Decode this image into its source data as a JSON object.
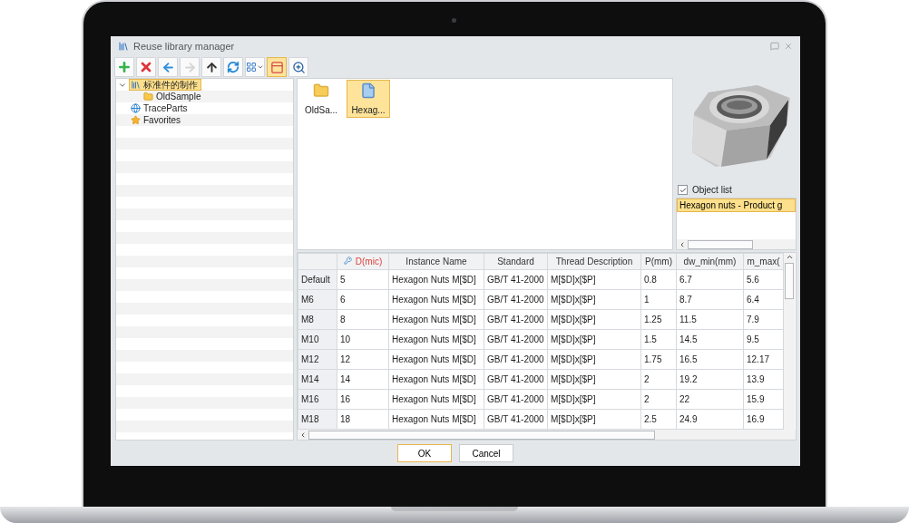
{
  "window": {
    "title": "Reuse library manager"
  },
  "toolbar": [
    {
      "kind": "add",
      "disabled": false,
      "selected": false
    },
    {
      "kind": "delete",
      "disabled": false,
      "selected": false
    },
    {
      "kind": "back",
      "disabled": false,
      "selected": false
    },
    {
      "kind": "forward",
      "disabled": true,
      "selected": false
    },
    {
      "kind": "up",
      "disabled": false,
      "selected": false
    },
    {
      "kind": "refresh",
      "disabled": false,
      "selected": false
    },
    {
      "kind": "view",
      "disabled": false,
      "selected": false
    },
    {
      "kind": "layout",
      "disabled": false,
      "selected": true
    },
    {
      "kind": "zoom",
      "disabled": false,
      "selected": false
    }
  ],
  "tree": [
    {
      "label": "标准件的制作",
      "kind": "library",
      "selected": true,
      "expanded": true,
      "children": [
        {
          "label": "OldSample",
          "kind": "folder",
          "selected": false
        }
      ]
    },
    {
      "label": "TraceParts",
      "kind": "web",
      "selected": false
    },
    {
      "label": "Favorites",
      "kind": "star",
      "selected": false
    }
  ],
  "files": [
    {
      "label": "OldSa...",
      "kind": "folder",
      "selected": false
    },
    {
      "label": "Hexag...",
      "kind": "file",
      "selected": true
    }
  ],
  "preview": {
    "kind": "picture",
    "object_list": {
      "label": "Object list",
      "checked": true,
      "items": [
        {
          "label": "Hexagon nuts - Product g",
          "selected": true
        }
      ]
    }
  },
  "grid": {
    "columns": [
      {
        "label": "D(mic)",
        "kind": "key"
      },
      {
        "label": "Instance Name",
        "kind": "plain"
      },
      {
        "label": "Standard",
        "kind": "plain"
      },
      {
        "label": "Thread Description",
        "kind": "plain"
      },
      {
        "label": "P(mm)",
        "kind": "plain"
      },
      {
        "label": "dw_min(mm)",
        "kind": "plain"
      },
      {
        "label": "m_max(",
        "kind": "plain"
      }
    ],
    "rows": [
      {
        "header": "Default",
        "cells": [
          "5",
          "Hexagon Nuts M[$D]",
          "GB/T 41-2000",
          "M[$D]x[$P]",
          "0.8",
          "6.7",
          "5.6"
        ]
      },
      {
        "header": "M6",
        "cells": [
          "6",
          "Hexagon Nuts M[$D]",
          "GB/T 41-2000",
          "M[$D]x[$P]",
          "1",
          "8.7",
          "6.4"
        ]
      },
      {
        "header": "M8",
        "cells": [
          "8",
          "Hexagon Nuts M[$D]",
          "GB/T 41-2000",
          "M[$D]x[$P]",
          "1.25",
          "11.5",
          "7.9"
        ]
      },
      {
        "header": "M10",
        "cells": [
          "10",
          "Hexagon Nuts M[$D]",
          "GB/T 41-2000",
          "M[$D]x[$P]",
          "1.5",
          "14.5",
          "9.5"
        ]
      },
      {
        "header": "M12",
        "cells": [
          "12",
          "Hexagon Nuts M[$D]",
          "GB/T 41-2000",
          "M[$D]x[$P]",
          "1.75",
          "16.5",
          "12.17"
        ]
      },
      {
        "header": "M14",
        "cells": [
          "14",
          "Hexagon Nuts M[$D]",
          "GB/T 41-2000",
          "M[$D]x[$P]",
          "2",
          "19.2",
          "13.9"
        ]
      },
      {
        "header": "M16",
        "cells": [
          "16",
          "Hexagon Nuts M[$D]",
          "GB/T 41-2000",
          "M[$D]x[$P]",
          "2",
          "22",
          "15.9"
        ]
      },
      {
        "header": "M18",
        "cells": [
          "18",
          "Hexagon Nuts M[$D]",
          "GB/T 41-2000",
          "M[$D]x[$P]",
          "2.5",
          "24.9",
          "16.9"
        ]
      }
    ]
  },
  "buttons": [
    {
      "label": "OK",
      "default": true
    },
    {
      "label": "Cancel",
      "default": false
    }
  ]
}
